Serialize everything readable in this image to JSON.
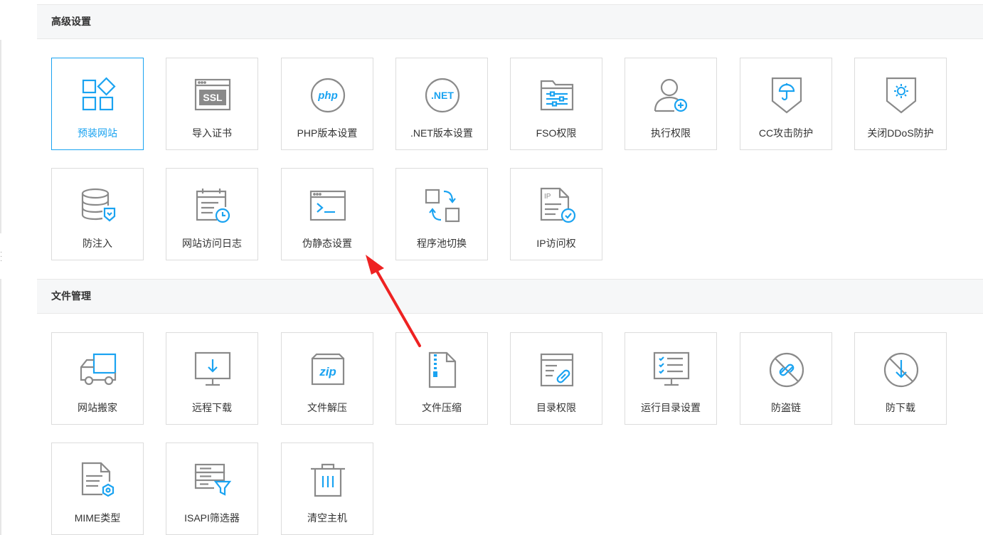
{
  "sections": [
    {
      "title": "高级设置",
      "tiles": [
        {
          "label": "预装网站",
          "icon": "preinstall-apps-icon"
        },
        {
          "label": "导入证书",
          "icon": "ssl-certificate-icon"
        },
        {
          "label": "PHP版本设置",
          "icon": "php-icon"
        },
        {
          "label": ".NET版本设置",
          "icon": "dotnet-icon"
        },
        {
          "label": "FSO权限",
          "icon": "folder-settings-icon"
        },
        {
          "label": "执行权限",
          "icon": "user-add-icon"
        },
        {
          "label": "CC攻击防护",
          "icon": "umbrella-shield-icon"
        },
        {
          "label": "关闭DDoS防护",
          "icon": "virus-shield-icon"
        },
        {
          "label": "防注入",
          "icon": "database-shield-icon"
        },
        {
          "label": "网站访问日志",
          "icon": "calendar-clock-icon"
        },
        {
          "label": "伪静态设置",
          "icon": "terminal-icon"
        },
        {
          "label": "程序池切换",
          "icon": "swap-icon"
        },
        {
          "label": "IP访问权",
          "icon": "ip-document-check-icon"
        }
      ]
    },
    {
      "title": "文件管理",
      "tiles": [
        {
          "label": "网站搬家",
          "icon": "truck-icon"
        },
        {
          "label": "远程下载",
          "icon": "monitor-download-icon"
        },
        {
          "label": "文件解压",
          "icon": "zip-box-icon"
        },
        {
          "label": "文件压缩",
          "icon": "zip-file-icon"
        },
        {
          "label": "目录权限",
          "icon": "directory-link-icon"
        },
        {
          "label": "运行目录设置",
          "icon": "checklist-monitor-icon"
        },
        {
          "label": "防盗链",
          "icon": "no-link-icon"
        },
        {
          "label": "防下载",
          "icon": "no-download-icon"
        },
        {
          "label": "MIME类型",
          "icon": "document-gear-icon"
        },
        {
          "label": "ISAPI筛选器",
          "icon": "server-filter-icon"
        },
        {
          "label": "清空主机",
          "icon": "trash-icon"
        }
      ]
    }
  ],
  "colors": {
    "accent": "#1aa3f1",
    "icon_gray": "#8a8a8a",
    "annotation_arrow": "#ee2222"
  }
}
